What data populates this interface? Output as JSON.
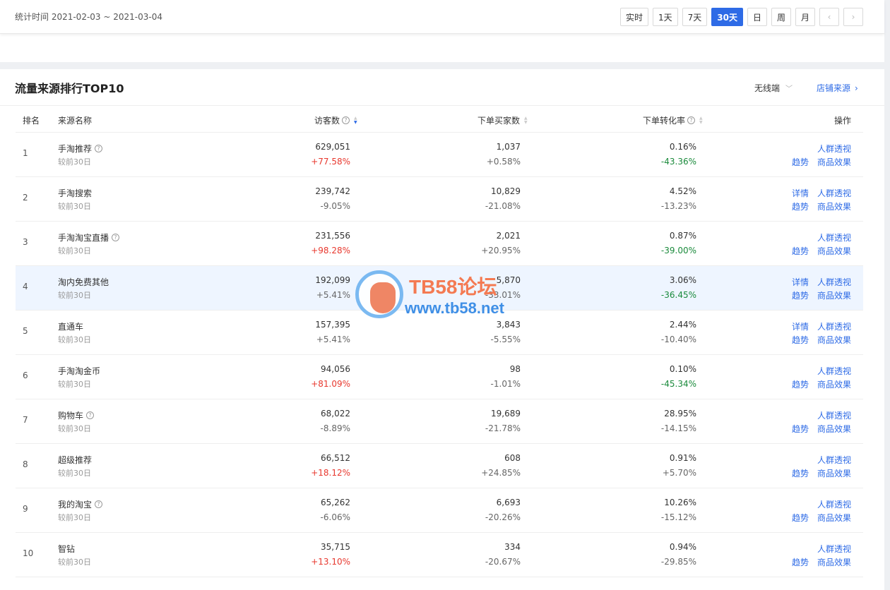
{
  "header": {
    "stat_time": "统计时间 2021-02-03 ~ 2021-03-04",
    "periods": [
      "实时",
      "1天",
      "7天",
      "30天",
      "日",
      "周",
      "月"
    ],
    "active_period": "30天",
    "prev_icon": "chevron-left-icon",
    "next_icon": "chevron-right-icon"
  },
  "panel": {
    "title": "流量来源排行TOP10",
    "device": "无线端",
    "shop_link": "店铺来源"
  },
  "table": {
    "columns": [
      "排名",
      "来源名称",
      "访客数",
      "下单买家数",
      "下单转化率",
      "操作"
    ],
    "compare_label": "较前30日",
    "op_labels": {
      "detail": "详情",
      "crowd": "人群透视",
      "trend": "趋势",
      "goods": "商品效果"
    },
    "rows": [
      {
        "rank": "1",
        "name": "手淘推荐",
        "help": true,
        "visitors": "629,051",
        "visitors_chg": "+77.58%",
        "buyers": "1,037",
        "buyers_chg": "+0.58%",
        "rate": "0.16%",
        "rate_chg": "-43.36%",
        "detail": false
      },
      {
        "rank": "2",
        "name": "手淘搜索",
        "help": false,
        "visitors": "239,742",
        "visitors_chg": "-9.05%",
        "buyers": "10,829",
        "buyers_chg": "-21.08%",
        "rate": "4.52%",
        "rate_chg": "-13.23%",
        "detail": true
      },
      {
        "rank": "3",
        "name": "手淘淘宝直播",
        "help": true,
        "visitors": "231,556",
        "visitors_chg": "+98.28%",
        "buyers": "2,021",
        "buyers_chg": "+20.95%",
        "rate": "0.87%",
        "rate_chg": "-39.00%",
        "detail": false
      },
      {
        "rank": "4",
        "name": "淘内免费其他",
        "help": false,
        "visitors": "192,099",
        "visitors_chg": "+5.41%",
        "buyers": "5,870",
        "buyers_chg": "-33.01%",
        "rate": "3.06%",
        "rate_chg": "-36.45%",
        "detail": true
      },
      {
        "rank": "5",
        "name": "直通车",
        "help": false,
        "visitors": "157,395",
        "visitors_chg": "+5.41%",
        "buyers": "3,843",
        "buyers_chg": "-5.55%",
        "rate": "2.44%",
        "rate_chg": "-10.40%",
        "detail": true
      },
      {
        "rank": "6",
        "name": "手淘淘金币",
        "help": false,
        "visitors": "94,056",
        "visitors_chg": "+81.09%",
        "buyers": "98",
        "buyers_chg": "-1.01%",
        "rate": "0.10%",
        "rate_chg": "-45.34%",
        "detail": false
      },
      {
        "rank": "7",
        "name": "购物车",
        "help": true,
        "visitors": "68,022",
        "visitors_chg": "-8.89%",
        "buyers": "19,689",
        "buyers_chg": "-21.78%",
        "rate": "28.95%",
        "rate_chg": "-14.15%",
        "detail": false
      },
      {
        "rank": "8",
        "name": "超级推荐",
        "help": false,
        "visitors": "66,512",
        "visitors_chg": "+18.12%",
        "buyers": "608",
        "buyers_chg": "+24.85%",
        "rate": "0.91%",
        "rate_chg": "+5.70%",
        "detail": false
      },
      {
        "rank": "9",
        "name": "我的淘宝",
        "help": true,
        "visitors": "65,262",
        "visitors_chg": "-6.06%",
        "buyers": "6,693",
        "buyers_chg": "-20.26%",
        "rate": "10.26%",
        "rate_chg": "-15.12%",
        "detail": false
      },
      {
        "rank": "10",
        "name": "智钻",
        "help": false,
        "visitors": "35,715",
        "visitors_chg": "+13.10%",
        "buyers": "334",
        "buyers_chg": "-20.67%",
        "rate": "0.94%",
        "rate_chg": "-29.85%",
        "detail": false
      }
    ]
  },
  "colors": {
    "accent": "#2e6be6",
    "up": "#e8382e",
    "down": "#1a8a3b",
    "highlight_row": "#eef5ff"
  },
  "watermark": {
    "title": "TB58论坛",
    "url": "www.tb58.net"
  }
}
